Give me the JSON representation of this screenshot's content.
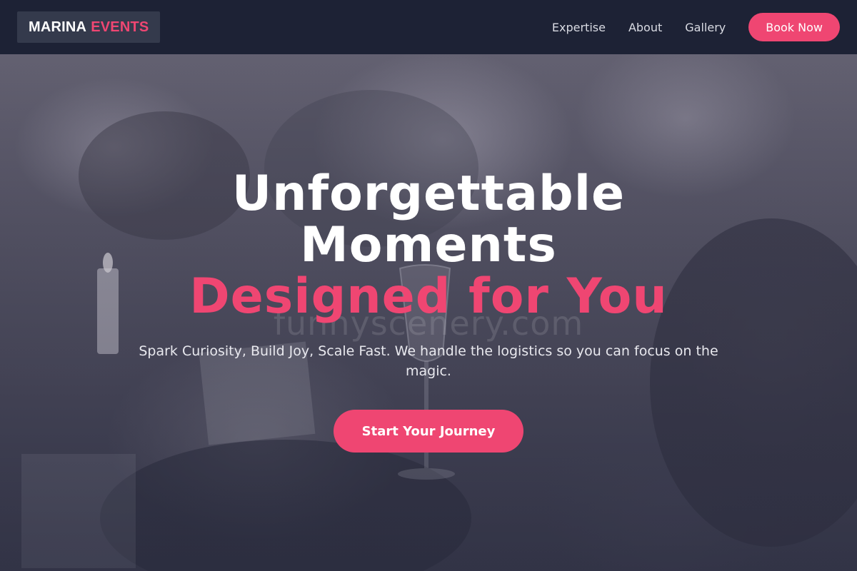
{
  "header": {
    "logo": {
      "word1": "MARINA",
      "word2": "EVENTS"
    },
    "nav": [
      {
        "label": "Expertise"
      },
      {
        "label": "About"
      },
      {
        "label": "Gallery"
      }
    ],
    "book_label": "Book Now"
  },
  "hero": {
    "headline_line1": "Unforgettable",
    "headline_line2": "Moments",
    "headline_accent": "Designed for You",
    "watermark": "funnyscenery.com",
    "subtitle": "Spark Curiosity, Build Joy, Scale Fast. We handle the logistics so you can focus on the magic.",
    "cta_label": "Start Your Journey",
    "background_image": "event-celebration-photo"
  },
  "colors": {
    "accent": "#ef4672",
    "header_bg": "#1d2235",
    "text_light": "#ffffff"
  }
}
